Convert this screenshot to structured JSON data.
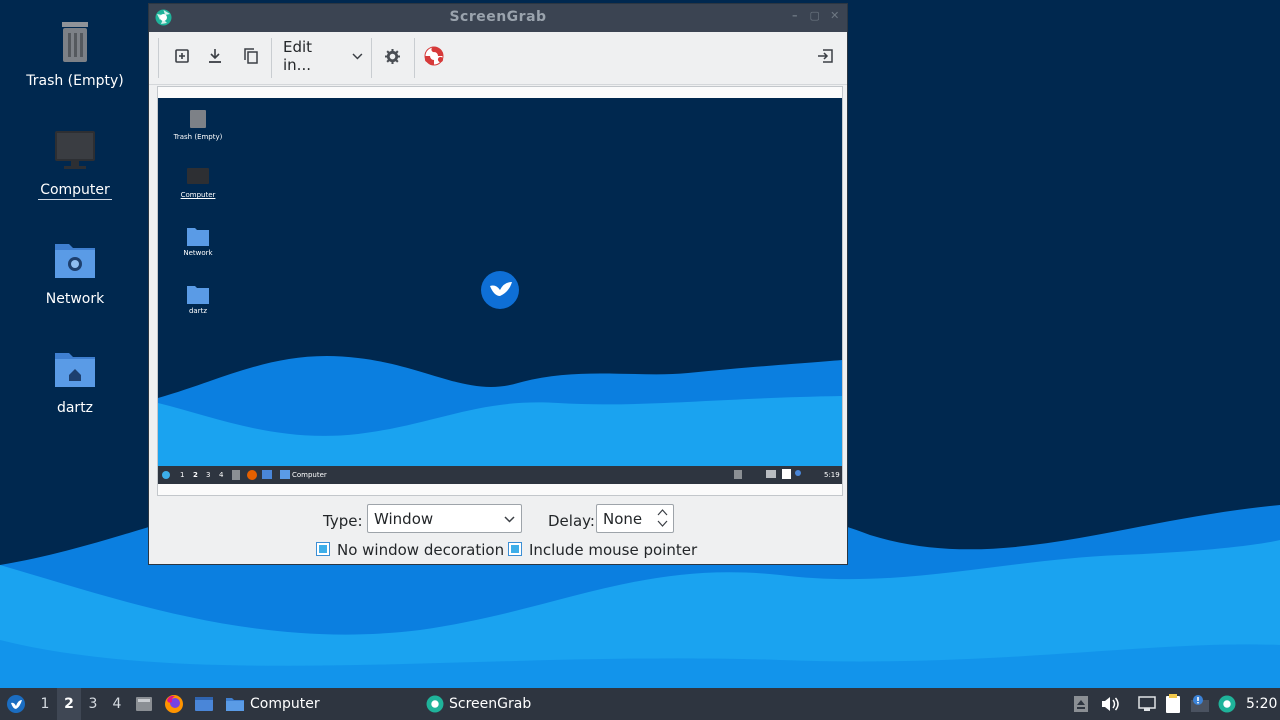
{
  "desktop": {
    "icons": [
      {
        "label": "Trash (Empty)",
        "icon": "trash-icon"
      },
      {
        "label": "Computer",
        "icon": "monitor-icon"
      },
      {
        "label": "Network",
        "icon": "network-folder-icon"
      },
      {
        "label": "dartz",
        "icon": "home-folder-icon"
      }
    ]
  },
  "window": {
    "title": "ScreenGrab",
    "toolbar": {
      "new_icon": "new-screenshot-icon",
      "save_icon": "save-download-icon",
      "copy_icon": "copy-icon",
      "edit_in_label": "Edit in...",
      "settings_icon": "gear-icon",
      "help_icon": "lifebuoy-icon",
      "exit_icon": "exit-icon"
    },
    "preview": {
      "icons": [
        "Trash (Empty)",
        "Computer",
        "Network",
        "dartz"
      ],
      "taskbar_workspaces": [
        "1",
        "2",
        "3",
        "4"
      ],
      "taskbar_task": "Computer",
      "clock": "5:19"
    },
    "options": {
      "type_label": "Type:",
      "type_value": "Window",
      "delay_label": "Delay:",
      "delay_value": "None",
      "no_decoration_label": "No window decoration",
      "no_decoration_checked": true,
      "include_pointer_label": "Include mouse pointer",
      "include_pointer_checked": true
    }
  },
  "taskbar": {
    "workspaces": [
      "1",
      "2",
      "3",
      "4"
    ],
    "active_workspace": "2",
    "tasks": [
      {
        "label": "Computer",
        "icon": "folder-icon"
      },
      {
        "label": "ScreenGrab",
        "icon": "screengrab-icon"
      }
    ],
    "clock": "5:20"
  },
  "colors": {
    "wallpaper": "#00284f",
    "wave_light": "#1aa3f0",
    "wave_dark": "#0a78dd",
    "accent": "#3daee9",
    "taskbar": "#2e3540",
    "titlebar": "#3b4452"
  }
}
